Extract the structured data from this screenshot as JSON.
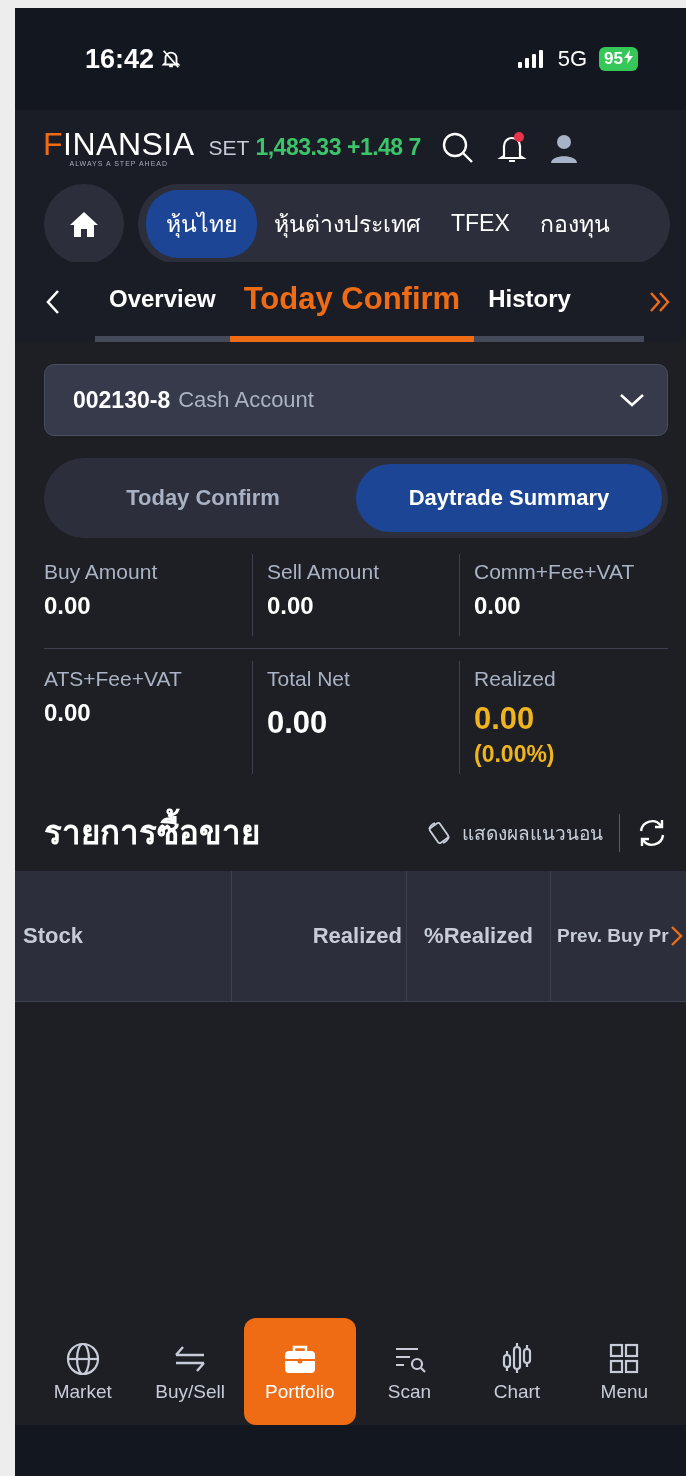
{
  "status_bar": {
    "time": "16:42",
    "network": "5G",
    "battery": "95"
  },
  "header": {
    "logo": "FINANSIA",
    "tagline": "ALWAYS A STEP AHEAD",
    "index_name": "SET",
    "index_value": "1,483.33",
    "index_change": "+1.48 7",
    "notification_unread": true
  },
  "market_tabs": [
    {
      "label": "หุ้นไทย",
      "selected": true
    },
    {
      "label": "หุ้นต่างประเทศ",
      "selected": false
    },
    {
      "label": "TFEX",
      "selected": false
    },
    {
      "label": "กองทุน",
      "selected": false
    }
  ],
  "page_tabs": [
    {
      "label": "Overview",
      "selected": false
    },
    {
      "label": "Today Confirm",
      "selected": true
    },
    {
      "label": "History",
      "selected": false
    }
  ],
  "account": {
    "number": "002130-8",
    "type": "Cash Account"
  },
  "segments": [
    {
      "label": "Today Confirm",
      "selected": false
    },
    {
      "label": "Daytrade Summary",
      "selected": true
    }
  ],
  "summary": [
    [
      {
        "label": "Buy Amount",
        "value": "0.00",
        "kind": "plain"
      },
      {
        "label": "Sell Amount",
        "value": "0.00",
        "kind": "plain"
      },
      {
        "label": "Comm+Fee+VAT",
        "value": "0.00",
        "kind": "plain"
      }
    ],
    [
      {
        "label": "ATS+Fee+VAT",
        "value": "0.00",
        "kind": "plain"
      },
      {
        "label": "Total Net",
        "value": "0.00",
        "kind": "large"
      },
      {
        "label": "Realized",
        "value": "0.00",
        "sub": "(0.00%)",
        "kind": "highlight"
      }
    ]
  ],
  "section": {
    "title": "รายการซื้อขาย",
    "landscape_label": "แสดงผลแนวนอน"
  },
  "table": {
    "columns": [
      "Stock",
      "Realized",
      "%Realized",
      "Prev. Buy Pr"
    ]
  },
  "bottom_nav": [
    {
      "label": "Market",
      "kind": "globe",
      "selected": false
    },
    {
      "label": "Buy/Sell",
      "kind": "swap",
      "selected": false
    },
    {
      "label": "Portfolio",
      "kind": "briefcase",
      "selected": true
    },
    {
      "label": "Scan",
      "kind": "scan",
      "selected": false
    },
    {
      "label": "Chart",
      "kind": "candles",
      "selected": false
    },
    {
      "label": "Menu",
      "kind": "grid",
      "selected": false
    }
  ]
}
